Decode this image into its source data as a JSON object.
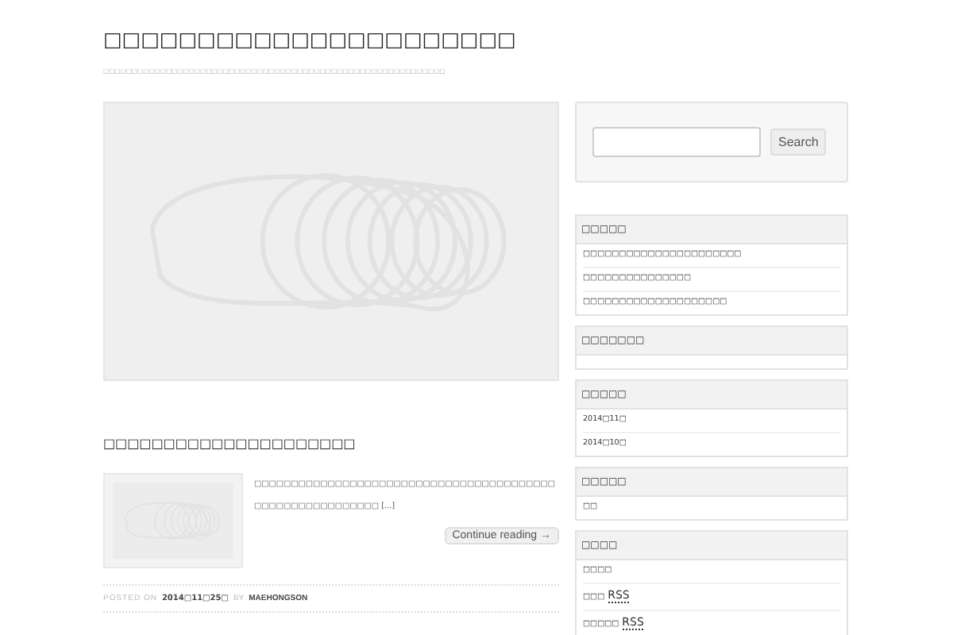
{
  "site": {
    "title": "□□□□□□□□□□□□□□□□□□□□□□",
    "tagline": "□□□□□□□□□□□□□□□□□□□□□□□□□□□□□□□□□□□□□□□□□□□□□□□□□□□□□□□□□□□□"
  },
  "post": {
    "title": "□□□□□□□□□□□□□□□□□□□□□",
    "excerpt": "□□□□□□□□□□□□□□□□□□□□□□□□□□□□□□□□□□□□□□□□□□□□□□□□□□□□□□□□□□ [...]",
    "continue": "Continue reading →",
    "posted_on": "POSTED ON",
    "date": "2014□11□25□",
    "by": "BY",
    "author": "MAEHONGSON"
  },
  "search": {
    "button": "Search"
  },
  "widgets": [
    {
      "title": "□□□□□",
      "items": [
        {
          "text": "□□□□□□□□□□□□□□□□□□□□□□"
        },
        {
          "text": "□□□□□□□□□□□□□□□"
        },
        {
          "text": "□□□□□□□□□□□□□□□□□□□□"
        }
      ]
    },
    {
      "title": "□□□□□□□"
    },
    {
      "title": "□□□□□",
      "items": [
        {
          "text": "2014□11□"
        },
        {
          "text": "2014□10□"
        }
      ]
    },
    {
      "title": "□□□□□",
      "items": [
        {
          "text": "□□"
        }
      ]
    },
    {
      "title": "□□□□",
      "items": [
        {
          "text": "□□□□"
        },
        {
          "text": "□□□",
          "abbr": "RSS"
        },
        {
          "text": "□□□□□",
          "abbr": "RSS"
        }
      ]
    }
  ]
}
